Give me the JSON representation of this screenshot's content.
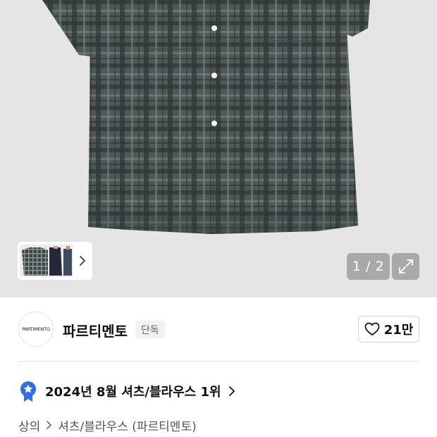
{
  "gallery": {
    "current": 1,
    "total": 2,
    "counter_text": "1 / 2",
    "product_image": "checked-short-sleeve-shirt",
    "thumbnails": [
      "shirt-flat",
      "shirt-model-back",
      "shirt-model-side"
    ]
  },
  "brand": {
    "logo_text": "PARTIMENTO",
    "name": "파르티멘토",
    "badge": "단독",
    "likes": "21만"
  },
  "ranking": {
    "text": "2024년 8월 셔츠/블라우스 1위"
  },
  "breadcrumb": {
    "category": "상의",
    "subcategory": "셔츠/블라우스 (파르티멘토)"
  },
  "colors": {
    "hero_bg": "#e5e5e5",
    "shirt": "#4a5252",
    "badge_blue": "#2f6fe4"
  },
  "icons": [
    "chevron-right-icon",
    "expand-icon",
    "heart-icon",
    "medal-icon"
  ]
}
